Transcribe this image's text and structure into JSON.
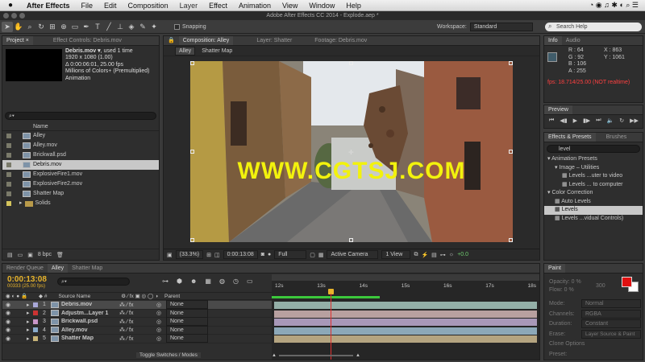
{
  "menubar": {
    "apple": "",
    "app": "After Effects",
    "items": [
      "File",
      "Edit",
      "Composition",
      "Layer",
      "Effect",
      "Animation",
      "View",
      "Window",
      "Help"
    ]
  },
  "titlebar": {
    "title": "Adobe After Effects CC 2014 - Explode.aep *"
  },
  "toolbar": {
    "snapping_label": "Snapping",
    "workspace_label": "Workspace:",
    "workspace_value": "Standard",
    "search_placeholder": "Search Help"
  },
  "project": {
    "tabs": [
      "Project ×",
      "Effect Controls: Debris.mov"
    ],
    "selected_name": "Debris.mov ▾",
    "used": ", used 1 time",
    "dims": "1920 x 1080 (1.00)",
    "duration": "Δ 0:00:06:01, 25.00 fps",
    "colors": "Millions of Colors+ (Premultiplied)",
    "kind": "Animation",
    "search_placeholder": "⌕▾",
    "name_header": "Name",
    "items": [
      {
        "name": "Alley",
        "kind": "comp"
      },
      {
        "name": "Alley.mov",
        "kind": "footage"
      },
      {
        "name": "Brickwall.psd",
        "kind": "psd"
      },
      {
        "name": "Debris.mov",
        "kind": "footage",
        "selected": true
      },
      {
        "name": "ExplosiveFire1.mov",
        "kind": "footage"
      },
      {
        "name": "ExplosiveFire2.mov",
        "kind": "footage"
      },
      {
        "name": "Shatter Map",
        "kind": "comp"
      },
      {
        "name": "Solids",
        "kind": "folder"
      }
    ],
    "bpc": "8 bpc"
  },
  "viewer": {
    "tabs": [
      "Composition: Alley",
      "Layer: Shatter",
      "Footage: Debris.mov"
    ],
    "subtabs": [
      "Alley",
      "Shatter Map"
    ],
    "watermark": "WWW.CGTSJ.COM",
    "zoom": "(33.3%)",
    "timecode": "0:00:13:08",
    "resolution": "Full",
    "camera": "Active Camera",
    "views": "1 View",
    "exposure": "+0.0"
  },
  "info": {
    "tabs": [
      "Info",
      "Audio"
    ],
    "r": "R : 64",
    "g": "G : 92",
    "b": "B : 106",
    "a": "A : 255",
    "x": "X : 863",
    "y": "Y : 1061",
    "fps": "fps: 18.714/25.00 (NOT realtime)"
  },
  "preview": {
    "tab": "Preview"
  },
  "effects": {
    "tabs": [
      "Effects & Presets",
      "Brushes"
    ],
    "search": "level",
    "tree": [
      {
        "text": "▾ Animation Presets",
        "indent": 0
      },
      {
        "text": "▾ Image – Utilities",
        "indent": 1
      },
      {
        "text": "Levels ...uter to video",
        "indent": 2
      },
      {
        "text": "Levels ... to computer",
        "indent": 2
      },
      {
        "text": "▾ Color Correction",
        "indent": 0
      },
      {
        "text": "Auto Levels",
        "indent": 1
      },
      {
        "text": "Levels",
        "indent": 1,
        "selected": true
      },
      {
        "text": "Levels ...vidual Controls)",
        "indent": 1
      }
    ]
  },
  "timeline": {
    "tabs": [
      "Render Queue",
      "Alley",
      "Shatter Map"
    ],
    "timecode": "0:00:13:08",
    "frames": "00333 (25.00 fps)",
    "search_placeholder": "⌕▾",
    "ruler": [
      "12s",
      "13s",
      "14s",
      "15s",
      "16s",
      "17s",
      "18s"
    ],
    "header_source": "Source Name",
    "header_parent": "Parent",
    "toggle": "Toggle Switches / Modes",
    "layers": [
      {
        "num": "1",
        "name": "Debris.mov",
        "color": "#a8a8d8",
        "parent": "None",
        "bar": "#94b0a8",
        "selected": true
      },
      {
        "num": "2",
        "name": "Adjustm...Layer 1",
        "color": "#cc3333",
        "parent": "None",
        "bar": "#b8a0a0"
      },
      {
        "num": "3",
        "name": "Brickwall.psd",
        "color": "#c896c8",
        "parent": "None",
        "bar": "#a898b8"
      },
      {
        "num": "4",
        "name": "Alley.mov",
        "color": "#8aaccc",
        "parent": "None",
        "bar": "#8ca8b8"
      },
      {
        "num": "5",
        "name": "Shatter Map",
        "color": "#c8b478",
        "parent": "None",
        "bar": "#b4a480"
      }
    ]
  },
  "paint": {
    "tab": "Paint",
    "opacity": "Opacity: 0 %",
    "flow": "Flow: 0 %",
    "size": "300",
    "mode_label": "Mode:",
    "mode": "Normal",
    "channels_label": "Channels:",
    "channels": "RGBA",
    "duration_label": "Duration:",
    "duration": "Constant",
    "erase_label": "Erase:",
    "erase": "Layer Source & Paint",
    "clone": "Clone Options",
    "preset": "Preset:",
    "fg_color": "#e01010",
    "bg_color": "#ffffff"
  }
}
